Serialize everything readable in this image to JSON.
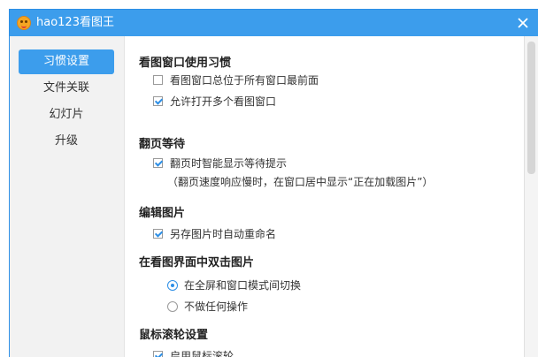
{
  "window": {
    "title": "hao123看图王",
    "close_glyph": "×"
  },
  "sidebar": {
    "items": [
      {
        "label": "习惯设置",
        "active": true
      },
      {
        "label": "文件关联",
        "active": false
      },
      {
        "label": "幻灯片",
        "active": false
      },
      {
        "label": "升级",
        "active": false
      }
    ]
  },
  "sections": {
    "viewer_window": {
      "title": "看图窗口使用习惯",
      "always_on_top": {
        "label": "看图窗口总位于所有窗口最前面",
        "checked": false
      },
      "allow_multiple": {
        "label": "允许打开多个看图窗口",
        "checked": true
      }
    },
    "page_wait": {
      "title": "翻页等待",
      "smart_wait": {
        "label": "翻页时智能显示等待提示",
        "checked": true
      },
      "hint": "（翻页速度响应慢时，在窗口居中显示“正在加载图片”）"
    },
    "edit_image": {
      "title": "编辑图片",
      "auto_rename": {
        "label": "另存图片时自动重命名",
        "checked": true
      }
    },
    "double_click": {
      "title": "在看图界面中双击图片",
      "toggle_fullscreen": {
        "label": "在全屏和窗口模式间切换",
        "selected": true
      },
      "no_action": {
        "label": "不做任何操作",
        "selected": false
      }
    },
    "mouse_wheel": {
      "title": "鼠标滚轮设置",
      "enable_wheel": {
        "label": "启用鼠标滚轮",
        "checked": true
      }
    }
  },
  "colors": {
    "accent": "#3c9dec",
    "check": "#2d8fe6"
  }
}
